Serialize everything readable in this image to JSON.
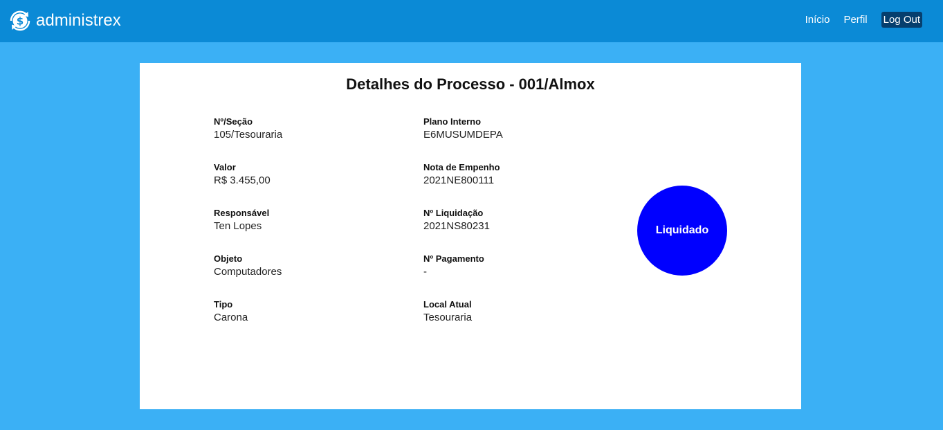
{
  "header": {
    "brand": "administrex",
    "nav": {
      "inicio": "Início",
      "perfil": "Perfil",
      "logout": "Log Out"
    }
  },
  "process": {
    "title": "Detalhes do Processo - 001/Almox",
    "left": [
      {
        "label": "Nº/Seção",
        "value": "105/Tesouraria"
      },
      {
        "label": "Valor",
        "value": "R$ 3.455,00"
      },
      {
        "label": "Responsável",
        "value": "Ten Lopes"
      },
      {
        "label": "Objeto",
        "value": "Computadores"
      },
      {
        "label": "Tipo",
        "value": "Carona"
      }
    ],
    "right": [
      {
        "label": "Plano Interno",
        "value": "E6MUSUMDEPA"
      },
      {
        "label": "Nota de Empenho",
        "value": "2021NE800111"
      },
      {
        "label": "Nº Liquidação",
        "value": "2021NS80231"
      },
      {
        "label": "Nº Pagamento",
        "value": "-"
      },
      {
        "label": "Local Atual",
        "value": "Tesouraria"
      }
    ],
    "status": "Liquidado"
  },
  "colors": {
    "page_bg": "#3bb0f5",
    "topbar": "#0b8ad6",
    "logout_bg": "#063f6e",
    "status_circle": "#0000ff"
  },
  "icons": {
    "brand": "dollar-refresh-icon"
  }
}
